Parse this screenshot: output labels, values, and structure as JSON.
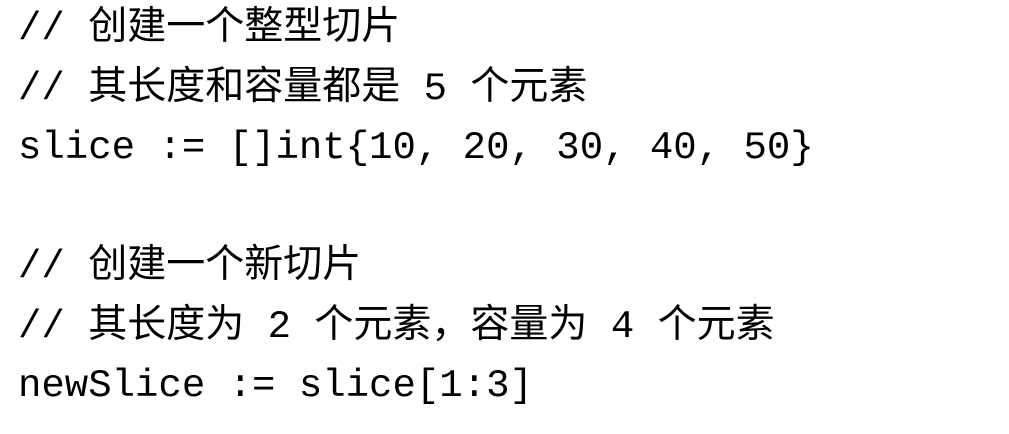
{
  "code": {
    "lines": [
      "// 创建一个整型切片",
      "// 其长度和容量都是 5 个元素",
      "slice := []int{10, 20, 30, 40, 50}",
      "",
      "// 创建一个新切片",
      "// 其长度为 2 个元素，容量为 4 个元素",
      "newSlice := slice[1:3]"
    ]
  }
}
